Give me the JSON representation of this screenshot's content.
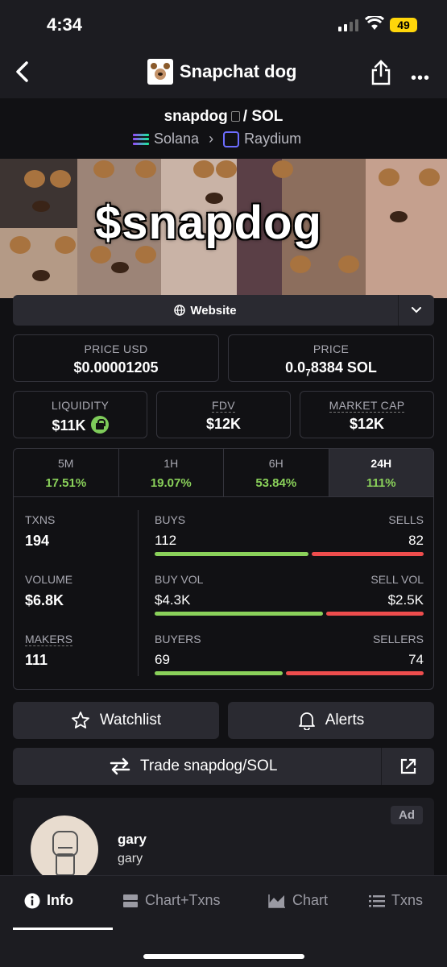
{
  "status": {
    "time": "4:34",
    "battery": "49"
  },
  "header": {
    "title": "Snapchat dog"
  },
  "pair": {
    "base": "snapdog",
    "sep": "/",
    "quote": "SOL",
    "chain": "Solana",
    "dex": "Raydium"
  },
  "banner": {
    "headline": "$snapdog"
  },
  "website": {
    "label": "Website"
  },
  "price": {
    "usd_label": "PRICE USD",
    "usd_value": "$0.00001205",
    "native_label": "PRICE",
    "native_prefix": "0.0",
    "native_sub": "7",
    "native_rest": "8384 SOL"
  },
  "metrics": {
    "liquidity_label": "LIQUIDITY",
    "liquidity_value": "$11K",
    "fdv_label": "FDV",
    "fdv_value": "$12K",
    "mcap_label": "MARKET CAP",
    "mcap_value": "$12K"
  },
  "timeframes": [
    {
      "label": "5M",
      "value": "17.51%"
    },
    {
      "label": "1H",
      "value": "19.07%"
    },
    {
      "label": "6H",
      "value": "53.84%"
    },
    {
      "label": "24H",
      "value": "111%"
    }
  ],
  "stats": {
    "txns_label": "TXNS",
    "txns_value": "194",
    "volume_label": "VOLUME",
    "volume_value": "$6.8K",
    "makers_label": "MAKERS",
    "makers_value": "111",
    "buys_label": "BUYS",
    "buys_value": "112",
    "sells_label": "SELLS",
    "sells_value": "82",
    "buyvol_label": "BUY VOL",
    "buyvol_value": "$4.3K",
    "sellvol_label": "SELL VOL",
    "sellvol_value": "$2.5K",
    "buyers_label": "BUYERS",
    "buyers_value": "69",
    "sellers_label": "SELLERS",
    "sellers_value": "74",
    "buy_ratio": 0.577,
    "buyvol_ratio": 0.632,
    "buyers_ratio": 0.483
  },
  "actions": {
    "watchlist": "Watchlist",
    "alerts": "Alerts",
    "trade": "Trade snapdog/SOL"
  },
  "ad": {
    "badge": "Ad",
    "name": "gary",
    "sub": "gary"
  },
  "tabs": {
    "info": "Info",
    "chart_txns": "Chart+Txns",
    "chart": "Chart",
    "txns": "Txns"
  },
  "colors": {
    "green": "#8ad15a",
    "red": "#ee4d4d",
    "bg": "#111114",
    "panel": "#2a2a31"
  }
}
